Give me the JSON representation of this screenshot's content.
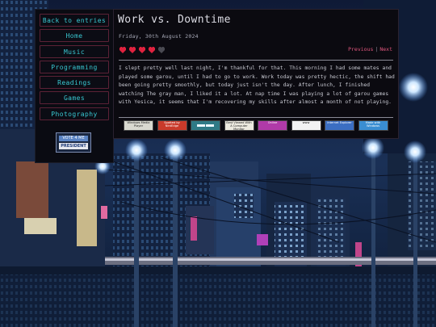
{
  "nav": {
    "items": [
      {
        "label": "Back to entries"
      },
      {
        "label": "Home"
      },
      {
        "label": "Music"
      },
      {
        "label": "Programming"
      },
      {
        "label": "Readings"
      },
      {
        "label": "Games"
      },
      {
        "label": "Photography"
      }
    ],
    "badge": {
      "top": "VOTE 4 ME",
      "bottom": "PRESIDENT"
    }
  },
  "post": {
    "title": "Work vs. Downtime",
    "date": "Friday, 30th August 2024",
    "rating": {
      "filled": 4,
      "total": 5,
      "filled_color": "#e0223f",
      "empty_color": "#4a4a52"
    },
    "nav_previous": "Previous",
    "nav_next": "Next",
    "body": "I slept pretty well last night, I'm thankful for that. This morning I had some mates and played some garou, until I had to go to work. Work today was pretty hectic, the shift had been going pretty smoothly, but today just isn't the day. After lunch, I finished watching The gray man, I liked it a lot. At nap time I was playing a lot of garou games with Yesica, it seems that I'm recovering my skills after almost a month of not playing."
  },
  "badges_88x31": [
    {
      "name": "windows-media-player-badge",
      "text": "Windows Media Player",
      "bg": "#d9d9d0",
      "fg": "#222"
    },
    {
      "name": "nintendo-badge",
      "text": "Spotted by NintEdge",
      "bg": "#c93a2a",
      "fg": "#fff"
    },
    {
      "name": "eyes-badge",
      "text": "",
      "bg": "#2f7a86",
      "fg": "#fff"
    },
    {
      "name": "computer-monitor-badge",
      "text": "Best Viewed With A Computer Monitor",
      "bg": "#eceae0",
      "fg": "#222"
    },
    {
      "name": "online-badge",
      "text": "Online",
      "bg": "#b03aa8",
      "fg": "#fff"
    },
    {
      "name": "www-badge",
      "text": "www",
      "bg": "#f2f2f2",
      "fg": "#111"
    },
    {
      "name": "internet-explorer-badge",
      "text": "Internet Explorer",
      "bg": "#3b6ec2",
      "fg": "#fff"
    },
    {
      "name": "windows-badge",
      "text": "Made with Windows",
      "bg": "#3a8ed2",
      "fg": "#fff"
    }
  ]
}
